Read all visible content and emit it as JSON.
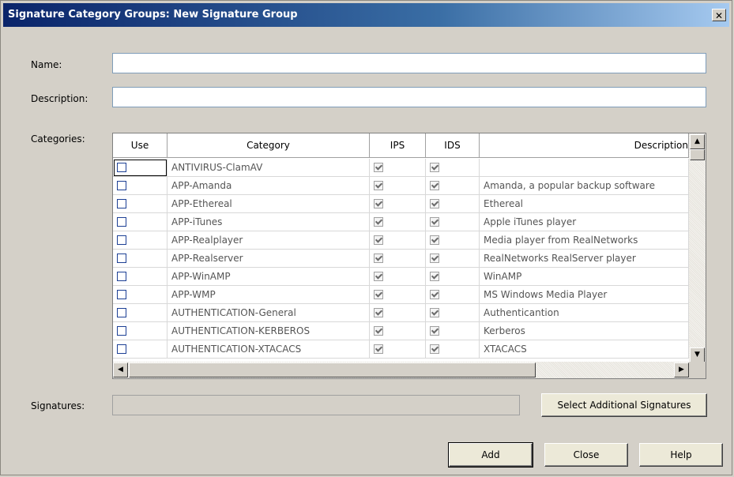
{
  "window": {
    "title": "Signature Category Groups: New Signature Group",
    "close_glyph": "✕"
  },
  "form": {
    "name_label": "Name:",
    "name_value": "",
    "description_label": "Description:",
    "description_value": "",
    "categories_label": "Categories:",
    "signatures_label": "Signatures:",
    "signatures_value": ""
  },
  "grid": {
    "columns": [
      "Use",
      "Category",
      "IPS",
      "IDS",
      "Description"
    ],
    "rows": [
      {
        "use": false,
        "category": "ANTIVIRUS-ClamAV",
        "ips": true,
        "ids": true,
        "description": ""
      },
      {
        "use": false,
        "category": "APP-Amanda",
        "ips": true,
        "ids": true,
        "description": "Amanda, a popular backup software"
      },
      {
        "use": false,
        "category": "APP-Ethereal",
        "ips": true,
        "ids": true,
        "description": "Ethereal"
      },
      {
        "use": false,
        "category": "APP-iTunes",
        "ips": true,
        "ids": true,
        "description": "Apple iTunes player"
      },
      {
        "use": false,
        "category": "APP-Realplayer",
        "ips": true,
        "ids": true,
        "description": "Media player from RealNetworks"
      },
      {
        "use": false,
        "category": "APP-Realserver",
        "ips": true,
        "ids": true,
        "description": "RealNetworks RealServer player"
      },
      {
        "use": false,
        "category": "APP-WinAMP",
        "ips": true,
        "ids": true,
        "description": "WinAMP"
      },
      {
        "use": false,
        "category": "APP-WMP",
        "ips": true,
        "ids": true,
        "description": "MS Windows Media Player"
      },
      {
        "use": false,
        "category": "AUTHENTICATION-General",
        "ips": true,
        "ids": true,
        "description": "Authenticantion"
      },
      {
        "use": false,
        "category": "AUTHENTICATION-KERBEROS",
        "ips": true,
        "ids": true,
        "description": "Kerberos"
      },
      {
        "use": false,
        "category": "AUTHENTICATION-XTACACS",
        "ips": true,
        "ids": true,
        "description": "XTACACS"
      }
    ]
  },
  "buttons": {
    "select_additional": "Select Additional Signatures",
    "add": "Add",
    "close": "Close",
    "help": "Help"
  },
  "scroll_glyphs": {
    "up": "▲",
    "down": "▼",
    "left": "◀",
    "right": "▶"
  }
}
